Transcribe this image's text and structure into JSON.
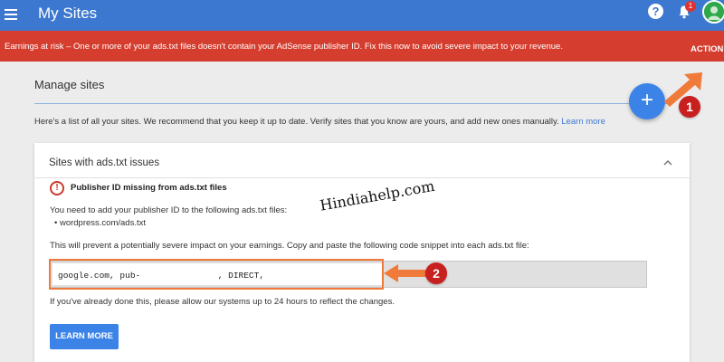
{
  "appbar": {
    "title": "My Sites",
    "notification_count": "1"
  },
  "alert": {
    "message": "Earnings at risk – One or more of your ads.txt files doesn't contain your AdSense publisher ID. Fix this now to avoid severe impact to your revenue.",
    "action_label": "ACTION"
  },
  "manage": {
    "title": "Manage sites",
    "description": "Here's a list of all your sites. We recommend that you keep it up to date. Verify sites that you know are yours, and add new ones manually.",
    "learn_more_link": "Learn more",
    "fab_label": "+"
  },
  "card": {
    "title": "Sites with ads.txt issues",
    "warning_title": "Publisher ID missing from ads.txt files",
    "need_text": "You need to add your publisher ID to the following ads.txt files:",
    "sites": [
      "wordpress.com/ads.txt"
    ],
    "prevent_text": "This will prevent a potentially severe impact on your earnings. Copy and paste the following code snippet into each ads.txt file:",
    "code_snippet": "google.com, pub-               , DIRECT,",
    "already_text": "If you've already done this, please allow our systems up to 24 hours to reflect the changes.",
    "learn_more_button": "LEARN MORE"
  },
  "annotations": {
    "marker_1": "1",
    "marker_2": "2",
    "watermark": "Hindiahelp.com",
    "arrow_color": "#f07a3a",
    "marker_color": "#c81f1f"
  },
  "colors": {
    "appbar": "#3c78d0",
    "alert": "#d53e2f",
    "primary_button": "#3c83e8"
  }
}
